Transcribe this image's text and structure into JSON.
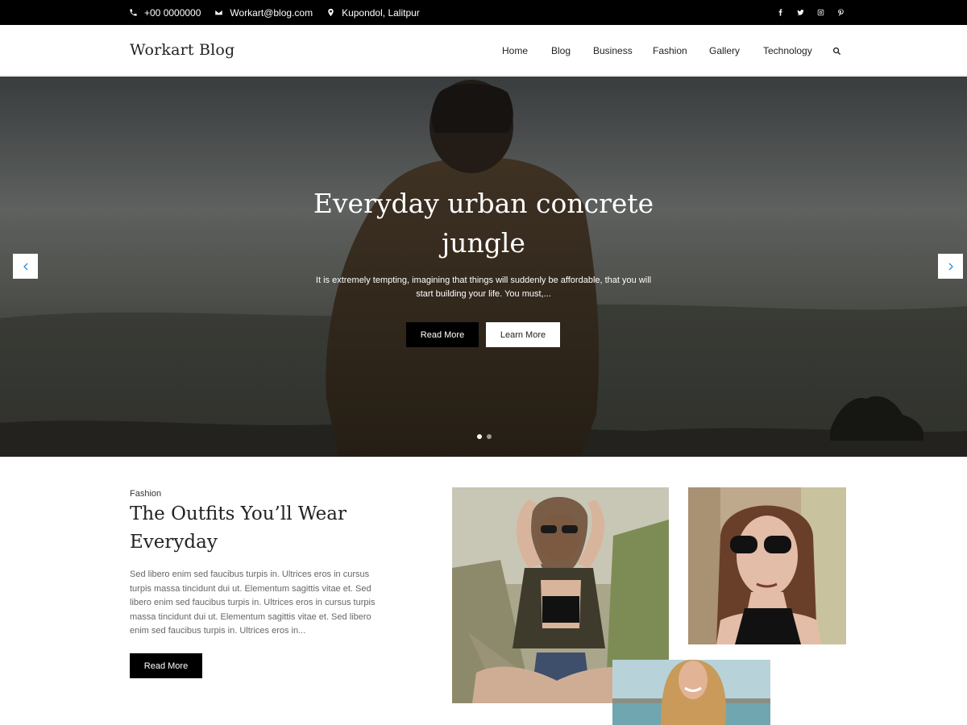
{
  "topbar": {
    "phone": "+00 0000000",
    "email": "Workart@blog.com",
    "address": "Kupondol, Lalitpur",
    "social": [
      "facebook-icon",
      "twitter-icon",
      "instagram-icon",
      "pinterest-icon"
    ]
  },
  "header": {
    "logo": "Workart Blog",
    "nav": [
      "Home",
      "Blog",
      "Business",
      "Fashion",
      "Gallery",
      "Technology"
    ]
  },
  "hero": {
    "title": "Everyday urban concrete jungle",
    "excerpt": "It is extremely tempting, imagining that things will suddenly be affordable, that you will start building your life. You must,...",
    "read_more": "Read More",
    "learn_more": "Learn More",
    "slides_total": 2,
    "slide_active": 1
  },
  "featured": {
    "category": "Fashion",
    "title": "The Outfits You’ll Wear Everyday",
    "excerpt": "Sed libero enim sed faucibus turpis in. Ultrices eros in cursus turpis massa tincidunt dui ut. Elementum sagittis vitae et. Sed libero enim sed faucibus turpis in. Ultrices eros in cursus turpis massa tincidunt dui ut. Elementum sagittis vitae et. Sed libero enim sed faucibus turpis in. Ultrices eros in...",
    "read_more": "Read More"
  },
  "colors": {
    "topbar_bg": "#000000",
    "button_dark": "#000000",
    "arrow_accent": "#2a8fd8"
  }
}
